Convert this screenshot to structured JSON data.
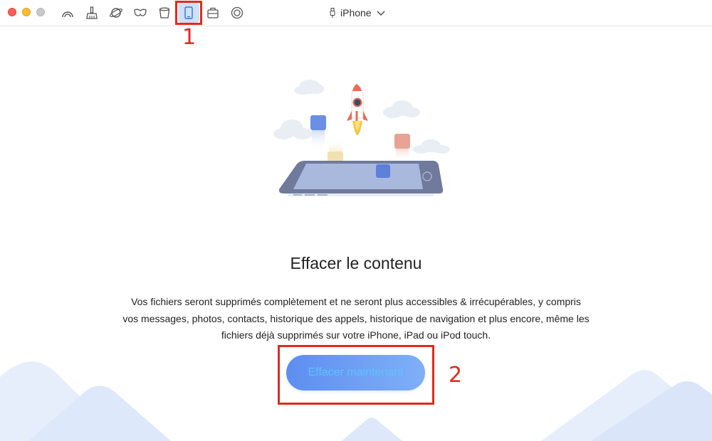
{
  "toolbar": {
    "tools": [
      {
        "name": "airbackup-icon"
      },
      {
        "name": "cleaner-icon"
      },
      {
        "name": "planet-icon"
      },
      {
        "name": "mask-icon"
      },
      {
        "name": "bin-icon"
      },
      {
        "name": "phone-erase-icon",
        "active": true
      },
      {
        "name": "toolkit-icon"
      },
      {
        "name": "settings-icon"
      }
    ],
    "device_label": "iPhone"
  },
  "annotations": {
    "mark1": "1",
    "mark2": "2",
    "color": "#e02b1d"
  },
  "main": {
    "title": "Effacer le contenu",
    "description": [
      "Vos fichiers seront supprimés complètement et ne seront plus accessibles & irrécupérables, y compris",
      "vos messages, photos, contacts, historique des appels, historique de navigation et plus encore, même les",
      "fichiers déjà supprimés sur votre iPhone, iPad ou iPod touch."
    ],
    "button_label": "Effacer maintenant"
  },
  "colors": {
    "accent": "#5d8ef0",
    "button_text": "#5cc3ff",
    "active_tool": "#cfe0fb"
  }
}
